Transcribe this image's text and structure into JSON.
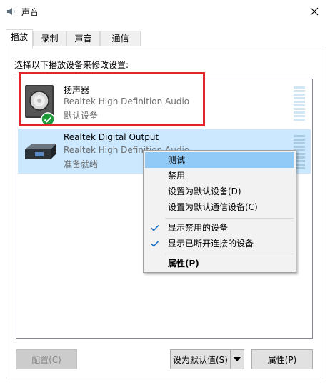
{
  "window": {
    "title": "声音",
    "icon": "speaker-icon",
    "close_icon": "close-icon"
  },
  "tabs": [
    {
      "label": "播放",
      "active": true
    },
    {
      "label": "录制",
      "active": false
    },
    {
      "label": "声音",
      "active": false
    },
    {
      "label": "通信",
      "active": false
    }
  ],
  "instruction": "选择以下播放设备来修改设置:",
  "devices": [
    {
      "name": "扬声器",
      "driver": "Realtek High Definition Audio",
      "status": "默认设备",
      "icon": "speaker-device-icon",
      "badge": "default-check-icon",
      "selected": false
    },
    {
      "name": "Realtek Digital Output",
      "driver": "Realtek High Definition Audio",
      "status": "准备就绪",
      "icon": "digital-output-icon",
      "selected": true
    }
  ],
  "context_menu": {
    "items": [
      {
        "label": "测试",
        "hover": true
      },
      {
        "label": "禁用"
      },
      {
        "label": "设置为默认设备(D)"
      },
      {
        "label": "设置为默认通信设备(C)"
      },
      {
        "label": "显示禁用的设备",
        "checked": true
      },
      {
        "label": "显示已断开连接的设备",
        "checked": true
      },
      {
        "label": "属性(P)",
        "bold": true
      }
    ]
  },
  "buttons": {
    "configure": "配置(C)",
    "set_default": "设为默认值(S)",
    "properties": "属性(P)"
  },
  "colors": {
    "selection": "#cce8ff",
    "menu_hover": "#91c9f7",
    "highlight": "#e0262b",
    "check": "#1a73c9"
  }
}
